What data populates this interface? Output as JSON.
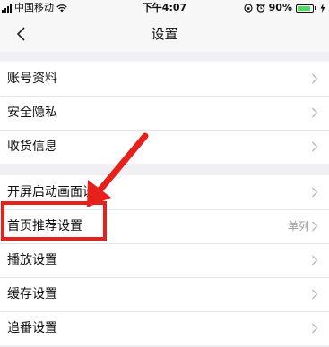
{
  "status_bar": {
    "carrier": "中国移动",
    "time": "下午4:07",
    "battery_percent": "90%",
    "icons": [
      "signal-icon",
      "wifi-icon",
      "rotation-lock-icon",
      "alarm-icon",
      "battery-icon",
      "charging-icon"
    ]
  },
  "nav": {
    "title": "设置",
    "back_icon": "chevron-left-icon"
  },
  "groups": [
    {
      "items": [
        {
          "label": "账号资料",
          "value": ""
        },
        {
          "label": "安全隐私",
          "value": ""
        },
        {
          "label": "收货信息",
          "value": ""
        }
      ]
    },
    {
      "items": [
        {
          "label": "开屏启动画面设",
          "value": ""
        },
        {
          "label": "首页推荐设置",
          "value": "单列"
        },
        {
          "label": "播放设置",
          "value": ""
        },
        {
          "label": "缓存设置",
          "value": ""
        },
        {
          "label": "追番设置",
          "value": ""
        }
      ]
    }
  ],
  "annotation": {
    "color": "#e8201b",
    "highlighted_item": "首页推荐设置",
    "arrow": "arrow-icon"
  }
}
